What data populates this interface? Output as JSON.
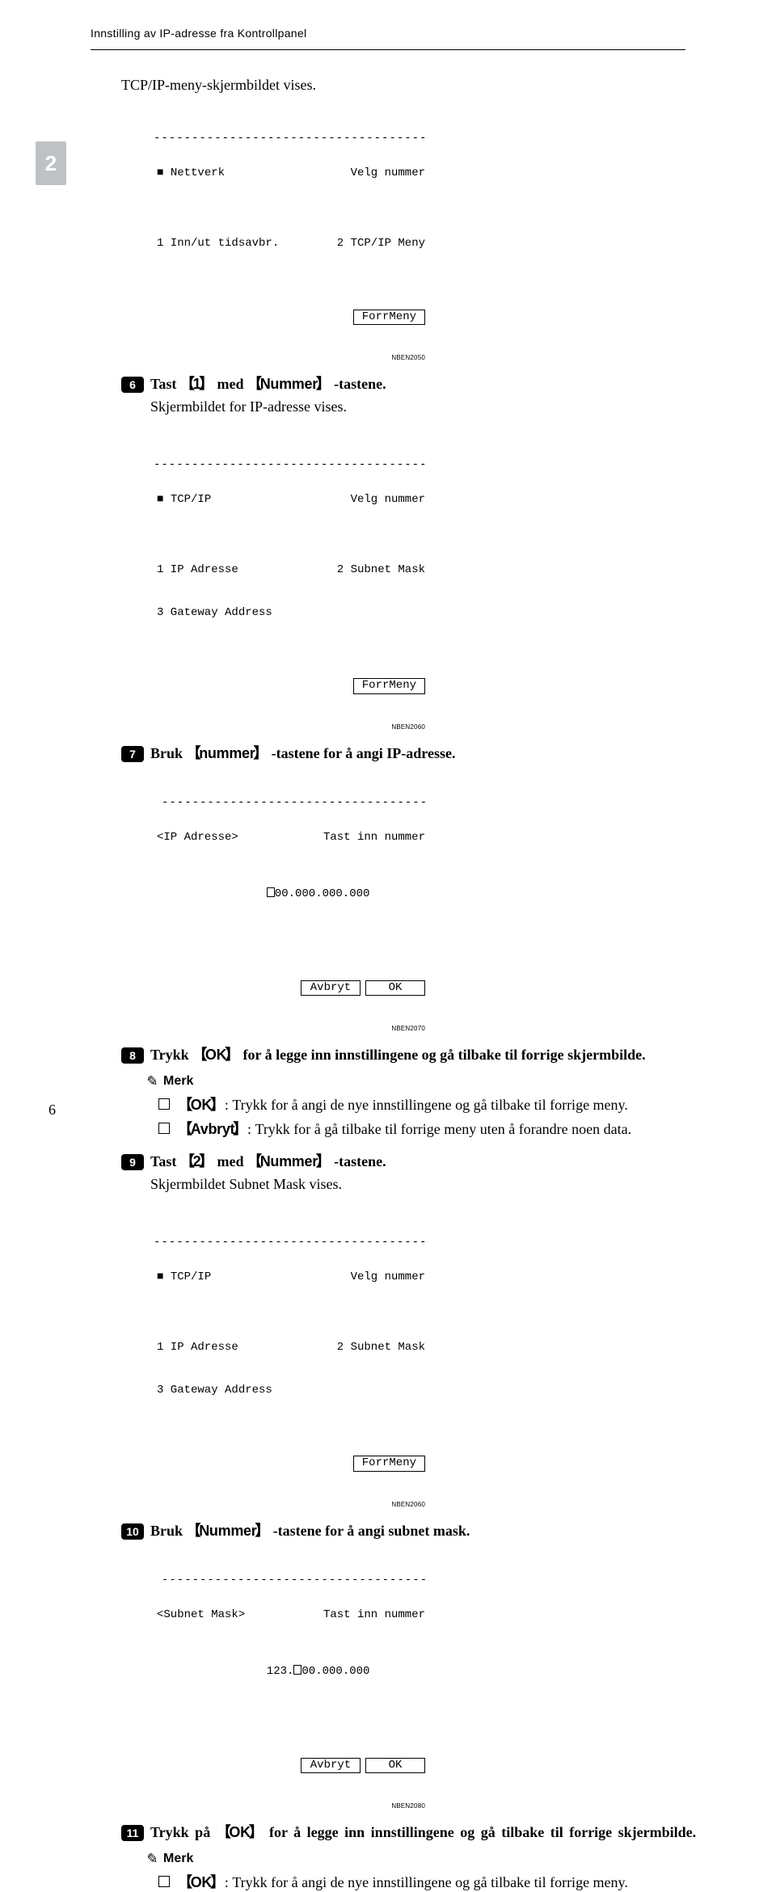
{
  "header": {
    "title": "Innstilling av IP-adresse fra Kontrollpanel"
  },
  "tab": "2",
  "intro": "TCP/IP-meny-skjermbildet vises.",
  "lcd1": {
    "title_left": "Nettverk",
    "title_right": "Velg nummer",
    "row1_left": "1 Inn/ut tidsavbr.",
    "row1_right": "2 TCP/IP Meny",
    "btn": "ForrMeny",
    "id": "NBEN2050"
  },
  "step6": {
    "num": "6",
    "text_a": "Tast ",
    "key1": "1",
    "text_b": " med ",
    "key2": "Nummer",
    "text_c": " -tastene.",
    "sub": "Skjermbildet for IP-adresse vises."
  },
  "lcd2": {
    "title_left": "TCP/IP",
    "title_right": "Velg nummer",
    "row1_left": "1 IP Adresse",
    "row1_right": "2 Subnet Mask",
    "row2": "3 Gateway Address",
    "btn": "ForrMeny",
    "id": "NBEN2060"
  },
  "step7": {
    "num": "7",
    "text_a": "Bruk ",
    "key": "nummer",
    "text_b": " -tastene for å angi IP-adresse."
  },
  "lcd3": {
    "title_left": "<IP Adresse>",
    "title_right": "Tast inn nummer",
    "value_rest": "00.000.000.000",
    "btn1": "Avbryt",
    "btn2": "OK",
    "id": "NBEN2070"
  },
  "step8": {
    "num": "8",
    "text_a": "Trykk ",
    "key": "OK",
    "text_b": " for å legge inn innstillingene og gå tilbake til forrige skjermbilde."
  },
  "note1": {
    "label": "Merk",
    "item1_key": "OK",
    "item1_text": ": Trykk for å angi de nye innstillingene og gå tilbake til forrige meny.",
    "item2_key": "Avbryt",
    "item2_text": ": Trykk for å gå tilbake til forrige meny uten å forandre noen data."
  },
  "step9": {
    "num": "9",
    "text_a": "Tast ",
    "key1": "2",
    "text_b": " med ",
    "key2": "Nummer",
    "text_c": " -tastene.",
    "sub": "Skjermbildet Subnet Mask vises."
  },
  "lcd4": {
    "title_left": "TCP/IP",
    "title_right": "Velg nummer",
    "row1_left": "1 IP Adresse",
    "row1_right": "2 Subnet Mask",
    "row2": "3 Gateway Address",
    "btn": "ForrMeny",
    "id": "NBEN2060"
  },
  "step10": {
    "num": "10",
    "text_a": "Bruk ",
    "key": "Nummer",
    "text_b": " -tastene for å angi subnet mask."
  },
  "lcd5": {
    "title_left": "<Subnet Mask>",
    "title_right": "Tast inn nummer",
    "value_pre": "123.",
    "value_rest": "00.000.000",
    "btn1": "Avbryt",
    "btn2": "OK",
    "id": "NBEN2080"
  },
  "step11": {
    "num": "11",
    "text_a": "Trykk på ",
    "key": "OK",
    "text_b": " for å legge inn innstillingene og gå tilbake til forrige skjermbilde."
  },
  "note2": {
    "label": "Merk",
    "item1_key": "OK",
    "item1_text": ": Trykk for å angi de nye innstillingene og gå tilbake til forrige meny."
  },
  "page_number": "6",
  "dashrow": "-------------------------------------------",
  "dashrow_short": "----------------------------------------"
}
